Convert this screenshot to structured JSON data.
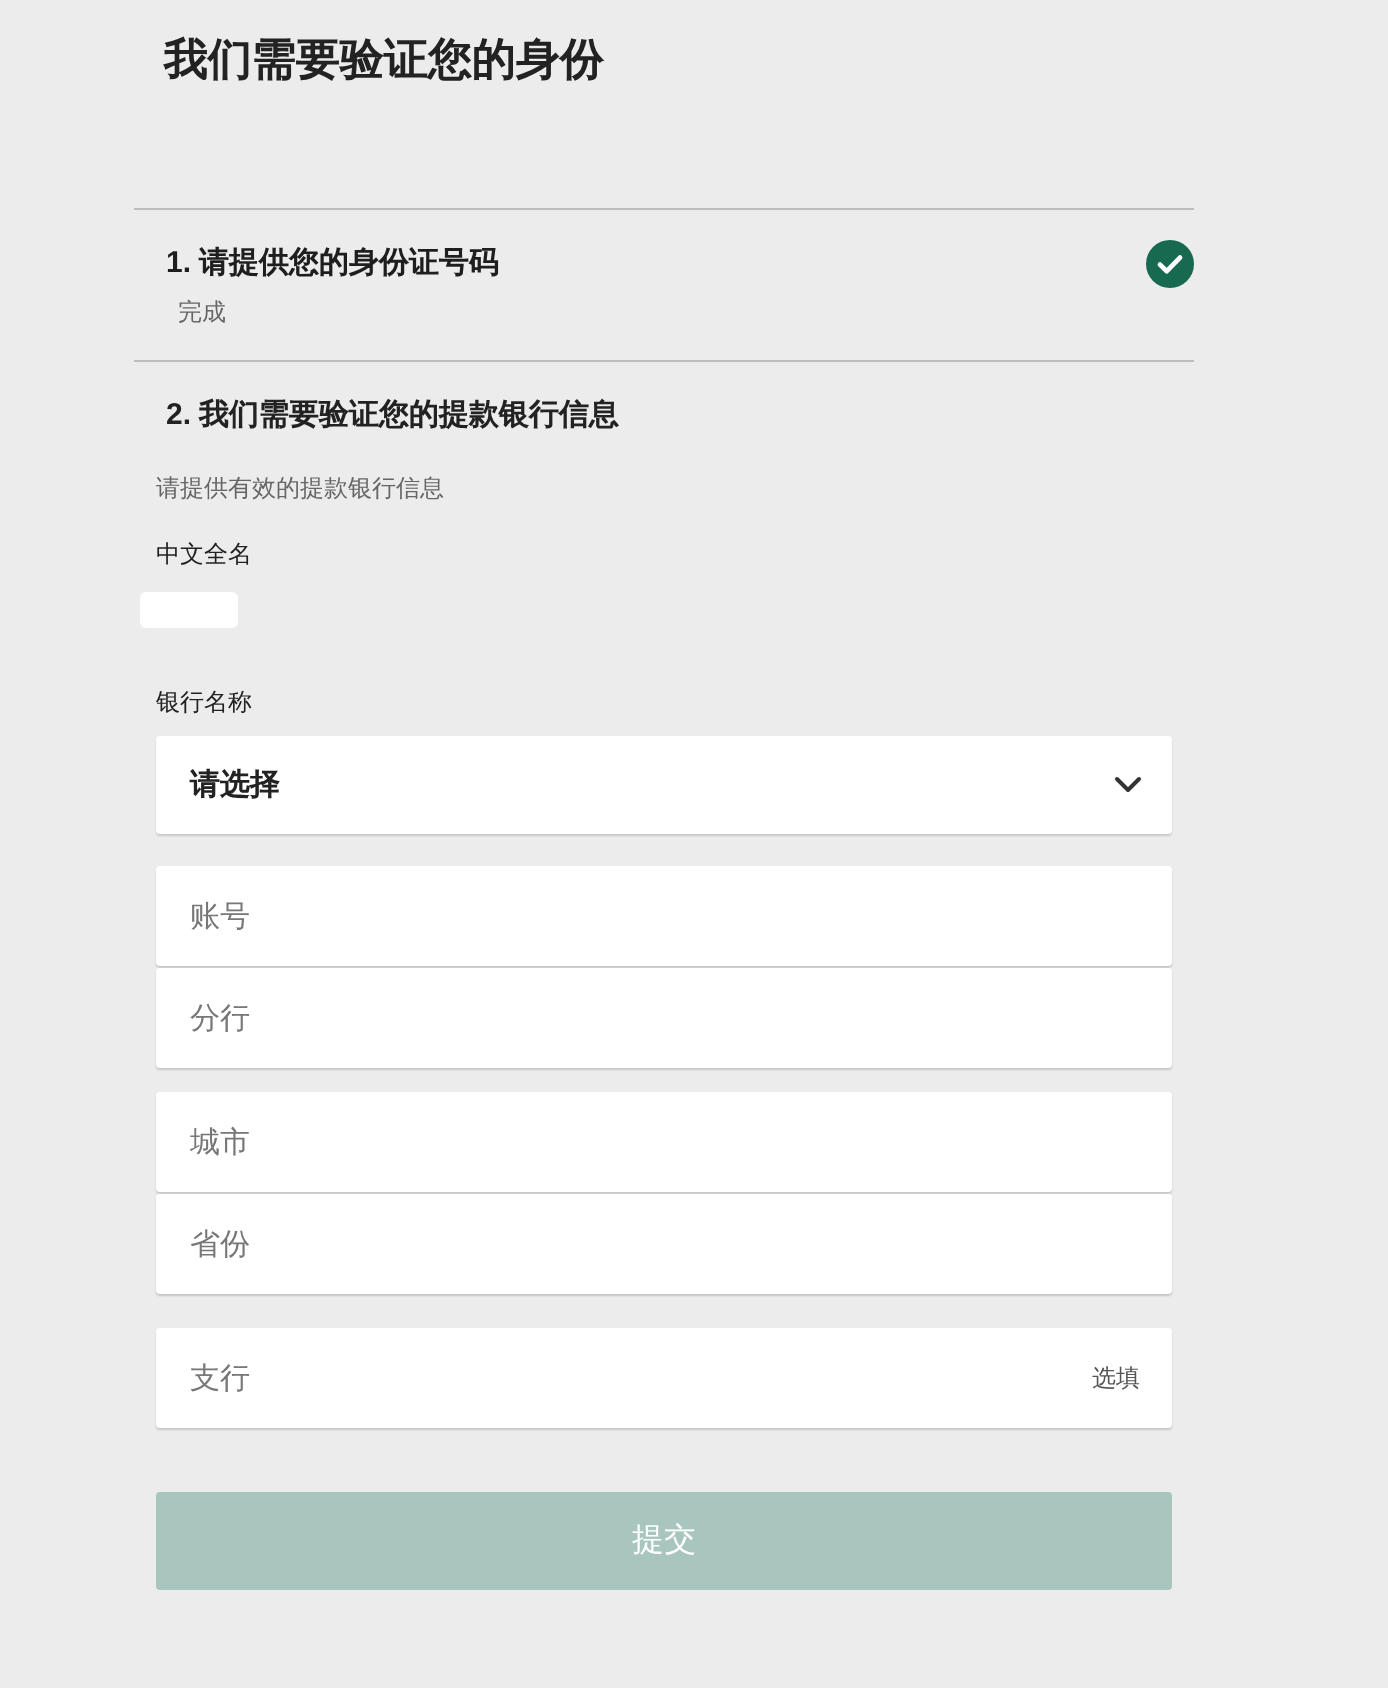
{
  "page": {
    "title": "我们需要验证您的身份"
  },
  "steps": [
    {
      "title": "1. 请提供您的身份证号码",
      "status": "完成",
      "completed": true
    },
    {
      "title": "2. 我们需要验证您的提款银行信息",
      "completed": false,
      "description": "请提供有效的提款银行信息",
      "name_field": {
        "label": "中文全名"
      },
      "bank_select": {
        "label": "银行名称",
        "value": "请选择"
      },
      "field_groups": [
        {
          "fields": [
            {
              "placeholder": "账号"
            },
            {
              "placeholder": "分行"
            }
          ]
        },
        {
          "fields": [
            {
              "placeholder": "城市"
            },
            {
              "placeholder": "省份"
            }
          ]
        },
        {
          "fields": [
            {
              "placeholder": "支行",
              "hint": "选填"
            }
          ]
        }
      ]
    }
  ],
  "submit_button": {
    "label": "提交",
    "disabled": true
  }
}
